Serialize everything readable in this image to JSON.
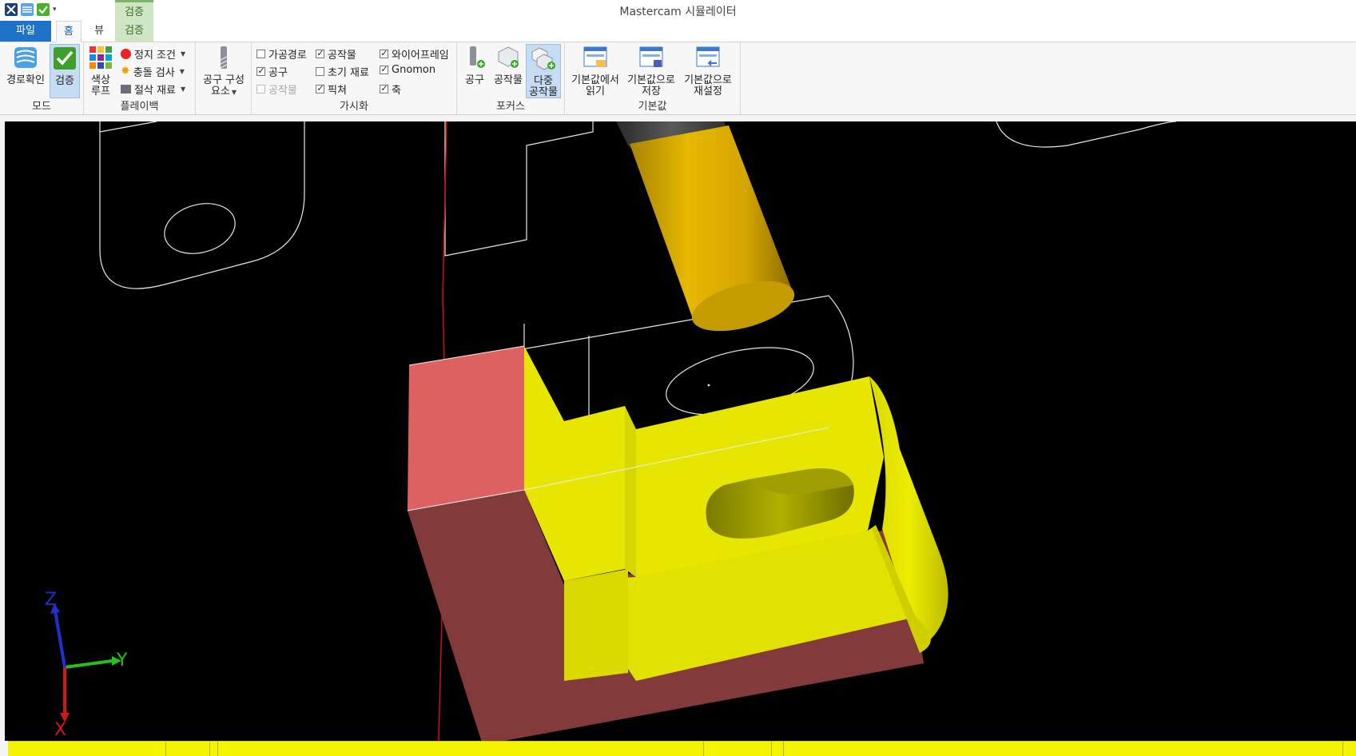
{
  "window": {
    "title": "Mastercam 시뮬레이터",
    "context_group": "검증"
  },
  "tabs": [
    {
      "label": "파일"
    },
    {
      "label": "홈"
    },
    {
      "label": "뷰"
    },
    {
      "label": "검증"
    }
  ],
  "ribbon": {
    "mode": {
      "label": "모드",
      "backplot_label": "경로확인",
      "verify_label": "검증"
    },
    "playback": {
      "label": "플레이백",
      "color_loop_line1": "색상",
      "color_loop_line2": "루프",
      "stop_condition": "정지 조건",
      "collision_check": "충돌 검사",
      "cut_stock": "절삭 재료"
    },
    "tool_components": {
      "line1": "공구 구성",
      "line2": "요소"
    },
    "visibility": {
      "label": "가시화",
      "toolpath": {
        "label": "가공경로",
        "checked": false
      },
      "workpiece": {
        "label": "공작물",
        "checked": true
      },
      "wireframe": {
        "label": "와이어프레임",
        "checked": true
      },
      "tool": {
        "label": "공구",
        "checked": true
      },
      "initial_stock": {
        "label": "초기 재료",
        "checked": false
      },
      "gnomon": {
        "label": "Gnomon",
        "checked": true
      },
      "workpiece2": {
        "label": "공작물",
        "checked": false
      },
      "fixture": {
        "label": "픽쳐",
        "checked": true
      },
      "axis": {
        "label": "축",
        "checked": true
      }
    },
    "focus": {
      "label": "포커스",
      "tool": "공구",
      "workpiece": "공작물",
      "multi_line1": "다중",
      "multi_line2": "공작물"
    },
    "defaults": {
      "label": "기본값",
      "load_line1": "기본값에서",
      "load_line2": "읽기",
      "save_line1": "기본값으로",
      "save_line2": "저장",
      "reset_line1": "기본값으로",
      "reset_line2": "재설정"
    }
  },
  "gnomon": {
    "z": "Z",
    "y": "Y",
    "x": "X"
  },
  "colors": {
    "viewport_bg": "#000000",
    "part_yellow": "#e6e600",
    "stock_pink": "#de6161",
    "stock_dark": "#833a3a",
    "tool_gold": "#d4aa00",
    "status_yellow": "#f4f400",
    "file_tab": "#1e72c8"
  }
}
